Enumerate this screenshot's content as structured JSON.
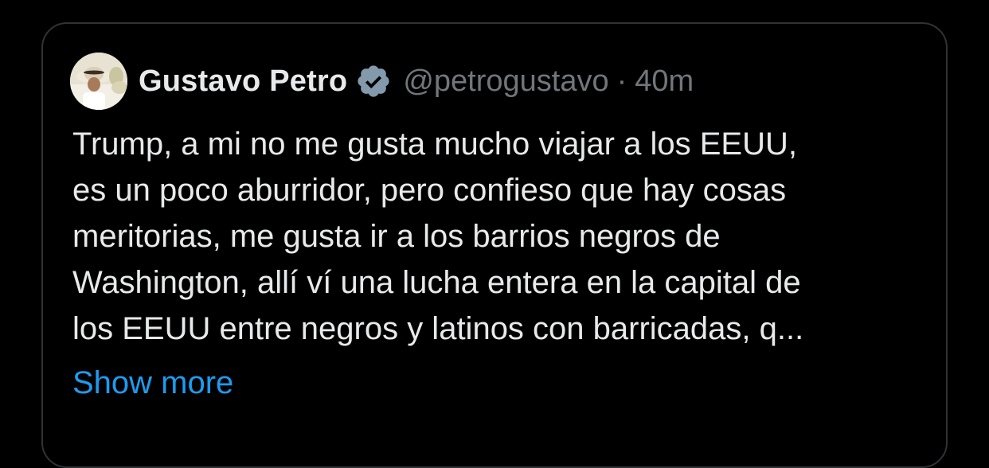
{
  "tweet": {
    "author": {
      "name": "Gustavo Petro",
      "handle": "@petrogustavo",
      "verified_icon": "verified-badge-icon",
      "avatar": "avatar-photo"
    },
    "separator": "·",
    "time": "40m",
    "text_lines": [
      "Trump, a mi no me gusta mucho viajar a los EEUU,",
      "es un poco aburridor, pero confieso que hay cosas",
      "meritorias, me gusta ir a los barrios negros de",
      "Washington, allí ví una lucha entera en la capital de",
      "los EEUU entre negros y latinos con barricadas, q..."
    ],
    "show_more_label": "Show more"
  },
  "colors": {
    "background": "#000000",
    "border": "#2f3336",
    "text": "#e7e9ea",
    "muted": "#71767b",
    "link": "#1d9bf0",
    "badge": "#829aab"
  }
}
